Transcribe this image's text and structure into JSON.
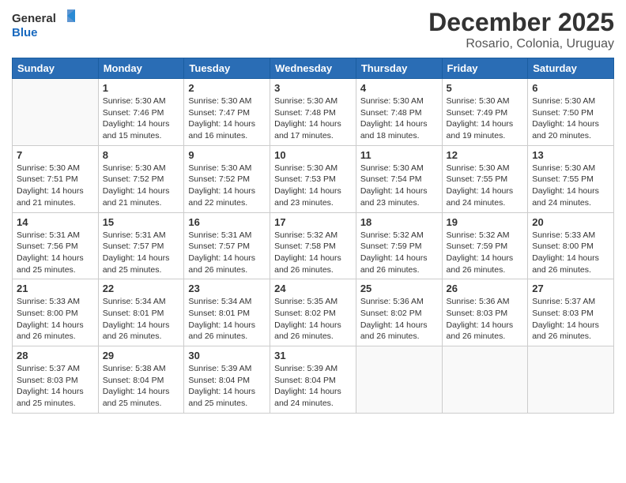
{
  "header": {
    "logo_general": "General",
    "logo_blue": "Blue",
    "month_title": "December 2025",
    "subtitle": "Rosario, Colonia, Uruguay"
  },
  "weekdays": [
    "Sunday",
    "Monday",
    "Tuesday",
    "Wednesday",
    "Thursday",
    "Friday",
    "Saturday"
  ],
  "weeks": [
    [
      {
        "day": "",
        "info": ""
      },
      {
        "day": "1",
        "info": "Sunrise: 5:30 AM\nSunset: 7:46 PM\nDaylight: 14 hours\nand 15 minutes."
      },
      {
        "day": "2",
        "info": "Sunrise: 5:30 AM\nSunset: 7:47 PM\nDaylight: 14 hours\nand 16 minutes."
      },
      {
        "day": "3",
        "info": "Sunrise: 5:30 AM\nSunset: 7:48 PM\nDaylight: 14 hours\nand 17 minutes."
      },
      {
        "day": "4",
        "info": "Sunrise: 5:30 AM\nSunset: 7:48 PM\nDaylight: 14 hours\nand 18 minutes."
      },
      {
        "day": "5",
        "info": "Sunrise: 5:30 AM\nSunset: 7:49 PM\nDaylight: 14 hours\nand 19 minutes."
      },
      {
        "day": "6",
        "info": "Sunrise: 5:30 AM\nSunset: 7:50 PM\nDaylight: 14 hours\nand 20 minutes."
      }
    ],
    [
      {
        "day": "7",
        "info": "Sunrise: 5:30 AM\nSunset: 7:51 PM\nDaylight: 14 hours\nand 21 minutes."
      },
      {
        "day": "8",
        "info": "Sunrise: 5:30 AM\nSunset: 7:52 PM\nDaylight: 14 hours\nand 21 minutes."
      },
      {
        "day": "9",
        "info": "Sunrise: 5:30 AM\nSunset: 7:52 PM\nDaylight: 14 hours\nand 22 minutes."
      },
      {
        "day": "10",
        "info": "Sunrise: 5:30 AM\nSunset: 7:53 PM\nDaylight: 14 hours\nand 23 minutes."
      },
      {
        "day": "11",
        "info": "Sunrise: 5:30 AM\nSunset: 7:54 PM\nDaylight: 14 hours\nand 23 minutes."
      },
      {
        "day": "12",
        "info": "Sunrise: 5:30 AM\nSunset: 7:55 PM\nDaylight: 14 hours\nand 24 minutes."
      },
      {
        "day": "13",
        "info": "Sunrise: 5:30 AM\nSunset: 7:55 PM\nDaylight: 14 hours\nand 24 minutes."
      }
    ],
    [
      {
        "day": "14",
        "info": "Sunrise: 5:31 AM\nSunset: 7:56 PM\nDaylight: 14 hours\nand 25 minutes."
      },
      {
        "day": "15",
        "info": "Sunrise: 5:31 AM\nSunset: 7:57 PM\nDaylight: 14 hours\nand 25 minutes."
      },
      {
        "day": "16",
        "info": "Sunrise: 5:31 AM\nSunset: 7:57 PM\nDaylight: 14 hours\nand 26 minutes."
      },
      {
        "day": "17",
        "info": "Sunrise: 5:32 AM\nSunset: 7:58 PM\nDaylight: 14 hours\nand 26 minutes."
      },
      {
        "day": "18",
        "info": "Sunrise: 5:32 AM\nSunset: 7:59 PM\nDaylight: 14 hours\nand 26 minutes."
      },
      {
        "day": "19",
        "info": "Sunrise: 5:32 AM\nSunset: 7:59 PM\nDaylight: 14 hours\nand 26 minutes."
      },
      {
        "day": "20",
        "info": "Sunrise: 5:33 AM\nSunset: 8:00 PM\nDaylight: 14 hours\nand 26 minutes."
      }
    ],
    [
      {
        "day": "21",
        "info": "Sunrise: 5:33 AM\nSunset: 8:00 PM\nDaylight: 14 hours\nand 26 minutes."
      },
      {
        "day": "22",
        "info": "Sunrise: 5:34 AM\nSunset: 8:01 PM\nDaylight: 14 hours\nand 26 minutes."
      },
      {
        "day": "23",
        "info": "Sunrise: 5:34 AM\nSunset: 8:01 PM\nDaylight: 14 hours\nand 26 minutes."
      },
      {
        "day": "24",
        "info": "Sunrise: 5:35 AM\nSunset: 8:02 PM\nDaylight: 14 hours\nand 26 minutes."
      },
      {
        "day": "25",
        "info": "Sunrise: 5:36 AM\nSunset: 8:02 PM\nDaylight: 14 hours\nand 26 minutes."
      },
      {
        "day": "26",
        "info": "Sunrise: 5:36 AM\nSunset: 8:03 PM\nDaylight: 14 hours\nand 26 minutes."
      },
      {
        "day": "27",
        "info": "Sunrise: 5:37 AM\nSunset: 8:03 PM\nDaylight: 14 hours\nand 26 minutes."
      }
    ],
    [
      {
        "day": "28",
        "info": "Sunrise: 5:37 AM\nSunset: 8:03 PM\nDaylight: 14 hours\nand 25 minutes."
      },
      {
        "day": "29",
        "info": "Sunrise: 5:38 AM\nSunset: 8:04 PM\nDaylight: 14 hours\nand 25 minutes."
      },
      {
        "day": "30",
        "info": "Sunrise: 5:39 AM\nSunset: 8:04 PM\nDaylight: 14 hours\nand 25 minutes."
      },
      {
        "day": "31",
        "info": "Sunrise: 5:39 AM\nSunset: 8:04 PM\nDaylight: 14 hours\nand 24 minutes."
      },
      {
        "day": "",
        "info": ""
      },
      {
        "day": "",
        "info": ""
      },
      {
        "day": "",
        "info": ""
      }
    ]
  ]
}
